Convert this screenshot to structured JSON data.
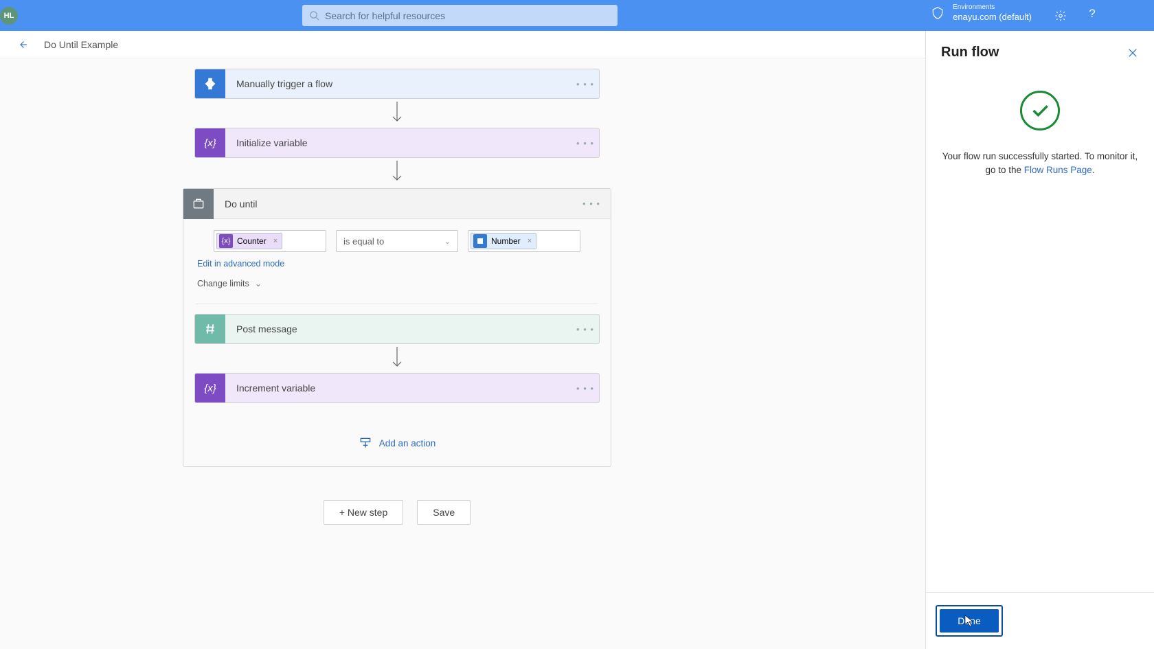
{
  "search": {
    "placeholder": "Search for helpful resources"
  },
  "environment": {
    "label": "Environments",
    "name": "enayu.com (default)"
  },
  "avatar": "HL",
  "breadcrumb": {
    "title": "Do Until Example"
  },
  "flow": {
    "trigger": {
      "title": "Manually trigger a flow"
    },
    "init_var": {
      "title": "Initialize variable"
    },
    "do_until": {
      "title": "Do until",
      "left_token": "Counter",
      "operator": "is equal to",
      "right_token": "Number",
      "edit_link": "Edit in advanced mode",
      "change_limits": "Change limits",
      "post_message": {
        "title": "Post message"
      },
      "increment": {
        "title": "Increment variable"
      },
      "add_action": "Add an action"
    }
  },
  "buttons": {
    "new_step": "+ New step",
    "save": "Save"
  },
  "panel": {
    "title": "Run flow",
    "message_pre": "Your flow run successfully started. To monitor it, go to the ",
    "link": "Flow Runs Page",
    "message_post": ".",
    "done": "Done"
  }
}
